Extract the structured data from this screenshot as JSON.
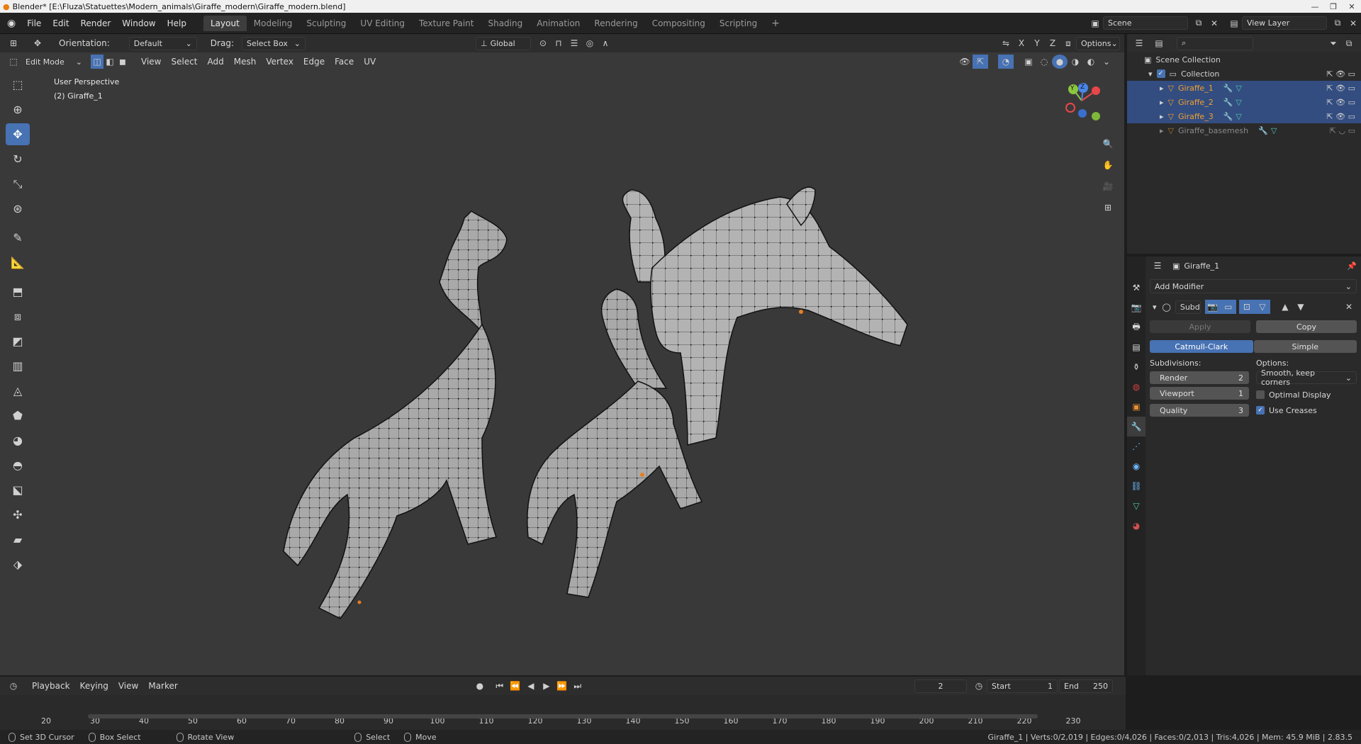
{
  "window": {
    "title": "Blender* [E:\\Fluza\\Statuettes\\Modern_animals\\Giraffe_modern\\Giraffe_modern.blend]",
    "controls": [
      "—",
      "❐",
      "✕"
    ]
  },
  "menu": [
    "File",
    "Edit",
    "Render",
    "Window",
    "Help"
  ],
  "workspaces": [
    "Layout",
    "Modeling",
    "Sculpting",
    "UV Editing",
    "Texture Paint",
    "Shading",
    "Animation",
    "Rendering",
    "Compositing",
    "Scripting"
  ],
  "active_workspace": "Layout",
  "scene": {
    "label": "Scene",
    "view_layer": "View Layer"
  },
  "tool_settings": {
    "orientation_label": "Orientation:",
    "orientation_value": "Default",
    "drag_label": "Drag:",
    "drag_value": "Select Box",
    "transform_space": "Global",
    "axes": [
      "X",
      "Y",
      "Z"
    ],
    "options": "Options"
  },
  "viewport_header": {
    "mode": "Edit Mode",
    "menus": [
      "View",
      "Select",
      "Add",
      "Mesh",
      "Vertex",
      "Edge",
      "Face",
      "UV"
    ]
  },
  "viewport": {
    "perspective": "User Perspective",
    "object_info": "(2) Giraffe_1",
    "gizmo_axes": [
      "Y",
      "Z"
    ]
  },
  "outliner": {
    "root": "Scene Collection",
    "collection": "Collection",
    "items": [
      {
        "name": "Giraffe_1",
        "selected": true
      },
      {
        "name": "Giraffe_2",
        "selected": true
      },
      {
        "name": "Giraffe_3",
        "selected": true
      },
      {
        "name": "Giraffe_basemesh",
        "selected": false
      }
    ]
  },
  "properties": {
    "object_name": "Giraffe_1",
    "add_modifier": "Add Modifier",
    "modifier_name": "Subd",
    "apply": "Apply",
    "copy": "Copy",
    "algorithms": [
      "Catmull-Clark",
      "Simple"
    ],
    "active_algorithm": "Catmull-Clark",
    "subdivisions_label": "Subdivisions:",
    "options_label": "Options:",
    "render_label": "Render",
    "render_value": "2",
    "viewport_label": "Viewport",
    "viewport_value": "1",
    "quality_label": "Quality",
    "quality_value": "3",
    "boundary_smooth": "Smooth, keep corners",
    "optimal_display": {
      "label": "Optimal Display",
      "checked": false
    },
    "use_creases": {
      "label": "Use Creases",
      "checked": true
    }
  },
  "timeline": {
    "menus": [
      "Playback",
      "Keying",
      "View",
      "Marker"
    ],
    "current_frame": "2",
    "start_label": "Start",
    "start_value": "1",
    "end_label": "End",
    "end_value": "250",
    "ticks": [
      "20",
      "30",
      "40",
      "50",
      "60",
      "70",
      "80",
      "90",
      "100",
      "110",
      "120",
      "130",
      "140",
      "150",
      "160",
      "170",
      "180",
      "190",
      "200",
      "210",
      "220",
      "230"
    ]
  },
  "status": {
    "left": [
      "Set 3D Cursor",
      "Box Select",
      "Rotate View",
      "Select",
      "Move"
    ],
    "right": "Giraffe_1 | Verts:0/2,019 | Edges:0/4,026 | Faces:0/2,013 | Tris:4,026 | Mem: 45.9 MiB | 2.83.5"
  },
  "colors": {
    "accent": "#4772b3",
    "selected_object": "#f0a030",
    "viewport_bg": "#393939",
    "mesh": "#a8a8a8"
  }
}
